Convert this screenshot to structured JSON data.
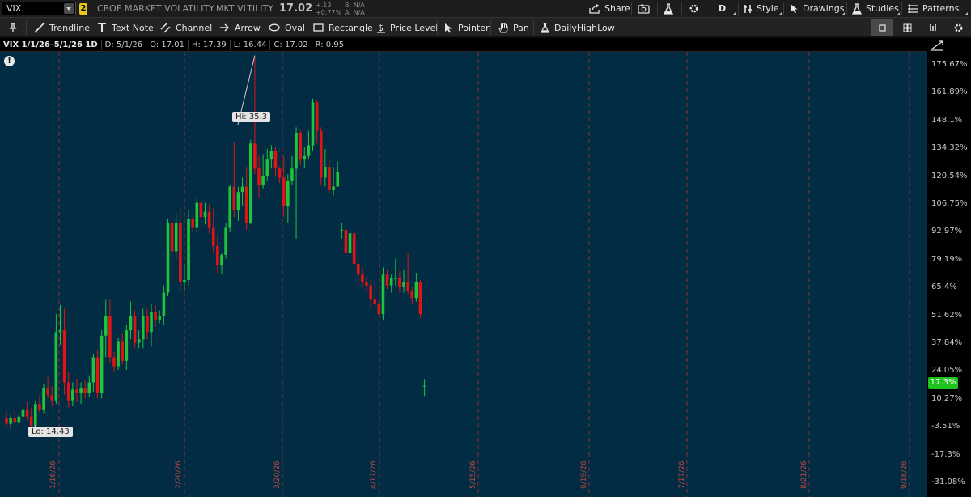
{
  "top_bar": {
    "symbol": "VIX",
    "link_badge": "2",
    "description": "CBOE MARKET VOLATILITY",
    "short_name": "MKT VLTILITY",
    "last_price": "17.02",
    "net_change": "+.13",
    "pct_change": "+0.77%",
    "bid": "B: N/A",
    "ask": "A: N/A",
    "share_label": "Share",
    "aggregation_label": "D",
    "style_label": "Style",
    "drawings_label": "Drawings",
    "studies_label": "Studies",
    "patterns_label": "Patterns"
  },
  "toolbar": {
    "tools": [
      "Trendline",
      "Text Note",
      "Channel",
      "Arrow",
      "Oval",
      "Rectangle",
      "Price Level",
      "Pointer",
      "Pan",
      "DailyHighLow"
    ]
  },
  "info_bar": {
    "title": "VIX 1/1/26–5/1/26 1D",
    "date": "D: 5/1/26",
    "open": "O: 17.01",
    "high": "H: 17.39",
    "low": "L: 16.44",
    "close": "C: 17.02",
    "range": "R: 0.95"
  },
  "chart": {
    "hi_label": "Hi: 35.3",
    "lo_label": "Lo: 14.43",
    "last_badge": "17.3%",
    "up_color": "#1fc33c",
    "down_color": "#e01414",
    "grid_color": "#a83232",
    "date_labels": [
      "1/16/26",
      "2/20/26",
      "3/20/26",
      "4/17/26",
      "5/15/26",
      "6/19/26",
      "7/17/26",
      "8/21/26",
      "9/18/26"
    ],
    "axis_ticks": [
      "175.67%",
      "161.89%",
      "148.1%",
      "134.32%",
      "120.54%",
      "106.75%",
      "92.97%",
      "79.19%",
      "65.4%",
      "51.62%",
      "37.84%",
      "24.05%",
      "10.27%",
      "-3.51%",
      "-17.3%",
      "-31.08%"
    ]
  },
  "chart_data": {
    "type": "candlestick",
    "symbol": "VIX",
    "ylim": [
      -31.08,
      175.67
    ],
    "x_range": [
      "1/1/26",
      "9/30/26"
    ],
    "candles": [
      {
        "o": 15.2,
        "h": 15.6,
        "l": 14.7,
        "c": 14.9
      },
      {
        "o": 14.9,
        "h": 15.4,
        "l": 14.6,
        "c": 15.2
      },
      {
        "o": 15.2,
        "h": 15.7,
        "l": 14.9,
        "c": 15.0
      },
      {
        "o": 15.0,
        "h": 15.5,
        "l": 14.8,
        "c": 15.3
      },
      {
        "o": 15.3,
        "h": 16.0,
        "l": 15.0,
        "c": 15.7
      },
      {
        "o": 15.7,
        "h": 16.1,
        "l": 15.1,
        "c": 15.3
      },
      {
        "o": 15.3,
        "h": 15.8,
        "l": 14.43,
        "c": 14.8
      },
      {
        "o": 14.8,
        "h": 16.2,
        "l": 14.6,
        "c": 16.0
      },
      {
        "o": 16.0,
        "h": 16.5,
        "l": 15.5,
        "c": 15.7
      },
      {
        "o": 15.7,
        "h": 17.1,
        "l": 15.5,
        "c": 16.9
      },
      {
        "o": 16.9,
        "h": 17.5,
        "l": 16.3,
        "c": 16.5
      },
      {
        "o": 16.5,
        "h": 17.0,
        "l": 15.9,
        "c": 16.2
      },
      {
        "o": 16.2,
        "h": 21.0,
        "l": 16.0,
        "c": 20.0
      },
      {
        "o": 20.0,
        "h": 21.5,
        "l": 19.3,
        "c": 20.1
      },
      {
        "o": 20.1,
        "h": 21.3,
        "l": 16.5,
        "c": 17.2
      },
      {
        "o": 17.2,
        "h": 17.8,
        "l": 15.8,
        "c": 16.2
      },
      {
        "o": 16.2,
        "h": 17.2,
        "l": 15.9,
        "c": 16.8
      },
      {
        "o": 16.8,
        "h": 17.4,
        "l": 16.1,
        "c": 16.6
      },
      {
        "o": 16.6,
        "h": 17.2,
        "l": 16.0,
        "c": 16.9
      },
      {
        "o": 16.9,
        "h": 17.3,
        "l": 16.3,
        "c": 16.6
      },
      {
        "o": 16.6,
        "h": 17.6,
        "l": 16.4,
        "c": 17.2
      },
      {
        "o": 17.2,
        "h": 18.8,
        "l": 16.7,
        "c": 18.6
      },
      {
        "o": 18.6,
        "h": 19.0,
        "l": 16.3,
        "c": 16.6
      },
      {
        "o": 16.6,
        "h": 20.1,
        "l": 16.3,
        "c": 19.8
      },
      {
        "o": 19.8,
        "h": 21.8,
        "l": 18.6,
        "c": 20.9
      },
      {
        "o": 20.9,
        "h": 21.8,
        "l": 18.3,
        "c": 18.6
      },
      {
        "o": 18.6,
        "h": 18.9,
        "l": 17.8,
        "c": 18.1
      },
      {
        "o": 18.1,
        "h": 19.7,
        "l": 17.9,
        "c": 19.5
      },
      {
        "o": 19.5,
        "h": 19.9,
        "l": 18.2,
        "c": 18.4
      },
      {
        "o": 18.4,
        "h": 20.4,
        "l": 17.9,
        "c": 20.1
      },
      {
        "o": 20.1,
        "h": 21.7,
        "l": 19.6,
        "c": 20.9
      },
      {
        "o": 20.9,
        "h": 21.2,
        "l": 19.1,
        "c": 19.4
      },
      {
        "o": 19.4,
        "h": 20.1,
        "l": 19.1,
        "c": 19.6
      },
      {
        "o": 19.6,
        "h": 21.3,
        "l": 19.1,
        "c": 20.9
      },
      {
        "o": 20.9,
        "h": 21.3,
        "l": 19.6,
        "c": 20.0
      },
      {
        "o": 20.0,
        "h": 21.6,
        "l": 19.2,
        "c": 21.1
      },
      {
        "o": 21.1,
        "h": 21.5,
        "l": 20.3,
        "c": 20.7
      },
      {
        "o": 20.7,
        "h": 21.2,
        "l": 20.5,
        "c": 20.9
      },
      {
        "o": 20.9,
        "h": 22.6,
        "l": 20.4,
        "c": 22.2
      },
      {
        "o": 22.2,
        "h": 26.3,
        "l": 22.0,
        "c": 26.1
      },
      {
        "o": 26.1,
        "h": 26.5,
        "l": 22.6,
        "c": 24.5
      },
      {
        "o": 24.5,
        "h": 26.6,
        "l": 24.1,
        "c": 26.1
      },
      {
        "o": 26.1,
        "h": 27.0,
        "l": 22.2,
        "c": 22.8
      },
      {
        "o": 22.8,
        "h": 23.8,
        "l": 22.3,
        "c": 22.9
      },
      {
        "o": 22.9,
        "h": 26.8,
        "l": 22.6,
        "c": 26.3
      },
      {
        "o": 26.3,
        "h": 26.6,
        "l": 25.6,
        "c": 25.8
      },
      {
        "o": 25.8,
        "h": 27.5,
        "l": 25.6,
        "c": 27.2
      },
      {
        "o": 27.2,
        "h": 27.6,
        "l": 25.8,
        "c": 26.4
      },
      {
        "o": 26.4,
        "h": 27.2,
        "l": 26.0,
        "c": 26.7
      },
      {
        "o": 26.7,
        "h": 27.1,
        "l": 25.5,
        "c": 25.8
      },
      {
        "o": 25.8,
        "h": 26.9,
        "l": 24.4,
        "c": 24.8
      },
      {
        "o": 24.8,
        "h": 25.4,
        "l": 23.3,
        "c": 23.7
      },
      {
        "o": 23.7,
        "h": 24.4,
        "l": 23.2,
        "c": 24.3
      },
      {
        "o": 24.3,
        "h": 26.1,
        "l": 24.1,
        "c": 25.8
      },
      {
        "o": 25.8,
        "h": 28.2,
        "l": 25.6,
        "c": 28.1
      },
      {
        "o": 28.1,
        "h": 30.6,
        "l": 26.4,
        "c": 26.8
      },
      {
        "o": 26.8,
        "h": 28.1,
        "l": 26.2,
        "c": 27.8
      },
      {
        "o": 27.8,
        "h": 28.6,
        "l": 27.0,
        "c": 28.1
      },
      {
        "o": 28.1,
        "h": 29.2,
        "l": 25.7,
        "c": 26.1
      },
      {
        "o": 26.1,
        "h": 30.7,
        "l": 26.0,
        "c": 30.5
      },
      {
        "o": 30.5,
        "h": 35.3,
        "l": 28.8,
        "c": 29.1
      },
      {
        "o": 29.1,
        "h": 29.8,
        "l": 27.5,
        "c": 28.2
      },
      {
        "o": 28.2,
        "h": 29.9,
        "l": 28.0,
        "c": 28.7
      },
      {
        "o": 28.7,
        "h": 30.2,
        "l": 28.4,
        "c": 29.6
      },
      {
        "o": 29.6,
        "h": 30.4,
        "l": 29.1,
        "c": 30.1
      },
      {
        "o": 30.1,
        "h": 30.3,
        "l": 28.7,
        "c": 29.1
      },
      {
        "o": 29.1,
        "h": 29.2,
        "l": 28.3,
        "c": 28.6
      },
      {
        "o": 28.6,
        "h": 29.8,
        "l": 26.4,
        "c": 27.0
      },
      {
        "o": 27.0,
        "h": 28.8,
        "l": 26.1,
        "c": 28.4
      },
      {
        "o": 28.4,
        "h": 29.8,
        "l": 28.2,
        "c": 29.1
      },
      {
        "o": 29.1,
        "h": 31.4,
        "l": 25.2,
        "c": 31.1
      },
      {
        "o": 31.1,
        "h": 31.3,
        "l": 29.3,
        "c": 29.6
      },
      {
        "o": 29.6,
        "h": 30.3,
        "l": 29.1,
        "c": 29.8
      },
      {
        "o": 29.8,
        "h": 31.2,
        "l": 29.6,
        "c": 30.4
      },
      {
        "o": 30.4,
        "h": 33.0,
        "l": 30.1,
        "c": 32.8
      },
      {
        "o": 32.8,
        "h": 32.9,
        "l": 30.5,
        "c": 31.2
      },
      {
        "o": 31.2,
        "h": 31.4,
        "l": 28.2,
        "c": 28.6
      },
      {
        "o": 28.6,
        "h": 30.2,
        "l": 28.1,
        "c": 29.2
      },
      {
        "o": 29.2,
        "h": 29.6,
        "l": 27.7,
        "c": 27.9
      },
      {
        "o": 27.9,
        "h": 29.2,
        "l": 27.6,
        "c": 28.1
      },
      {
        "o": 28.1,
        "h": 29.5,
        "l": 28.1,
        "c": 28.9
      },
      {
        "o": 25.7,
        "h": 26.1,
        "l": 25.2,
        "c": 25.7
      },
      {
        "o": 25.7,
        "h": 26.0,
        "l": 24.2,
        "c": 24.4
      },
      {
        "o": 24.4,
        "h": 25.8,
        "l": 24.0,
        "c": 25.5
      },
      {
        "o": 25.5,
        "h": 25.9,
        "l": 23.6,
        "c": 23.8
      },
      {
        "o": 23.8,
        "h": 24.1,
        "l": 22.6,
        "c": 23.2
      },
      {
        "o": 23.2,
        "h": 23.6,
        "l": 22.5,
        "c": 22.8
      },
      {
        "o": 22.8,
        "h": 23.1,
        "l": 22.3,
        "c": 22.6
      },
      {
        "o": 22.6,
        "h": 22.9,
        "l": 21.3,
        "c": 21.8
      },
      {
        "o": 21.8,
        "h": 22.8,
        "l": 21.5,
        "c": 21.6
      },
      {
        "o": 21.6,
        "h": 21.9,
        "l": 20.8,
        "c": 21.0
      },
      {
        "o": 21.0,
        "h": 23.6,
        "l": 20.7,
        "c": 23.2
      },
      {
        "o": 23.2,
        "h": 23.5,
        "l": 22.4,
        "c": 22.6
      },
      {
        "o": 22.6,
        "h": 23.2,
        "l": 22.2,
        "c": 23.0
      },
      {
        "o": 23.0,
        "h": 24.1,
        "l": 22.6,
        "c": 23.0
      },
      {
        "o": 23.0,
        "h": 23.4,
        "l": 22.2,
        "c": 22.5
      },
      {
        "o": 22.5,
        "h": 23.5,
        "l": 22.2,
        "c": 22.8
      },
      {
        "o": 22.8,
        "h": 24.4,
        "l": 22.1,
        "c": 22.3
      },
      {
        "o": 22.3,
        "h": 22.5,
        "l": 21.6,
        "c": 21.9
      },
      {
        "o": 21.9,
        "h": 23.3,
        "l": 21.7,
        "c": 22.8
      },
      {
        "o": 22.8,
        "h": 22.9,
        "l": 20.8,
        "c": 21.0
      },
      {
        "o": 17.01,
        "h": 17.39,
        "l": 16.44,
        "c": 17.02
      }
    ]
  }
}
